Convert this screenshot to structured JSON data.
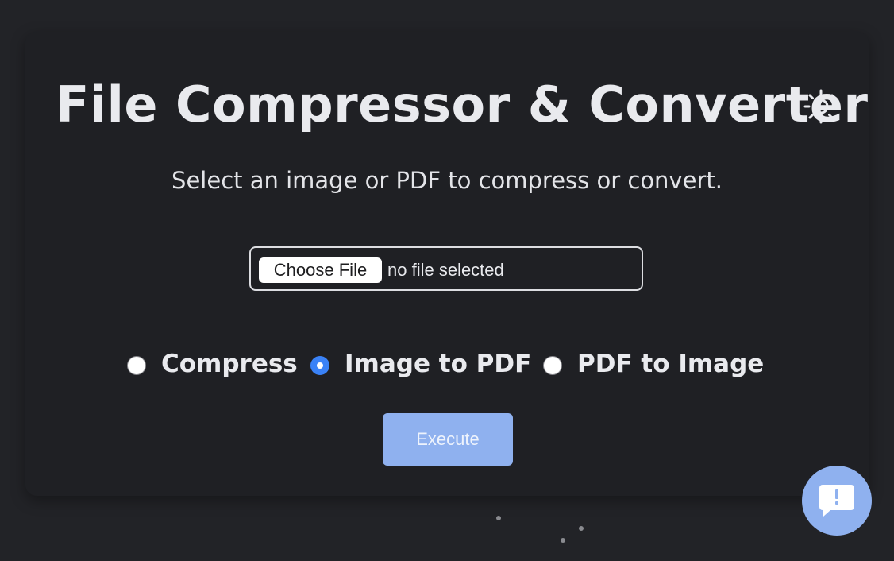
{
  "header": {
    "title": "File Compressor & Converter",
    "theme_toggle_icon": "sun-icon"
  },
  "subtitle": "Select an image or PDF to compress or convert.",
  "file_input": {
    "button_label": "Choose File",
    "status": "no file selected"
  },
  "options": {
    "selected": "Image to PDF",
    "items": [
      {
        "label": "Compress",
        "checked": false
      },
      {
        "label": "Image to PDF",
        "checked": true
      },
      {
        "label": "PDF to Image",
        "checked": false
      }
    ]
  },
  "execute_label": "Execute",
  "feedback_icon": "feedback-icon",
  "colors": {
    "background": "#222327",
    "accent": "#3a82f7",
    "button": "#8fb1ef"
  }
}
